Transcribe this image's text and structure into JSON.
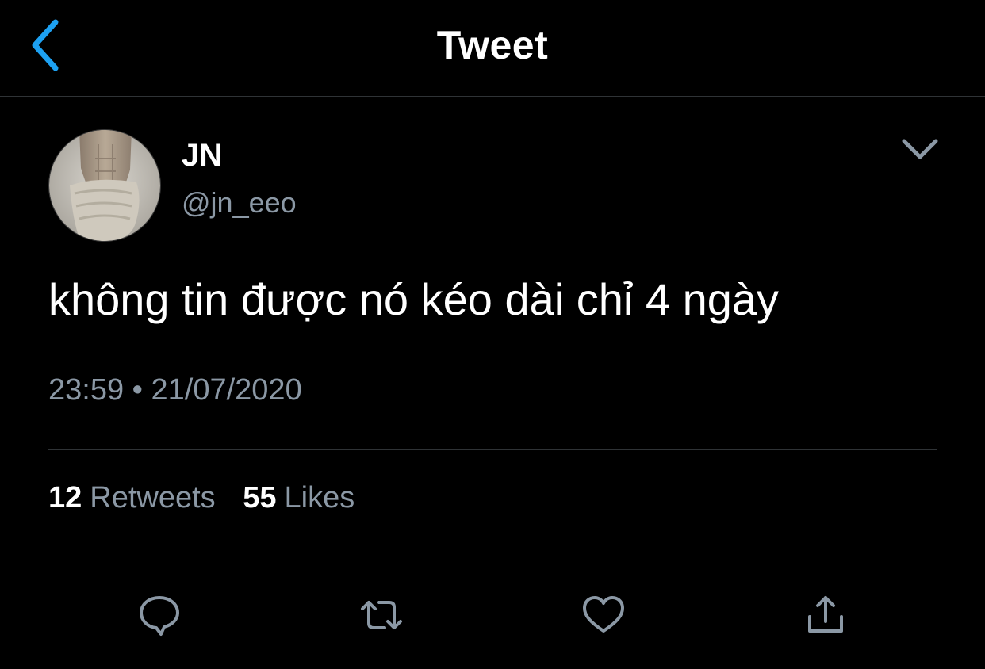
{
  "header": {
    "back_icon": "chevron-left-icon",
    "title": "Tweet",
    "accent_color": "#1da1f2"
  },
  "tweet": {
    "author": {
      "display_name": "JN",
      "handle": "@jn_eeo",
      "avatar": "avatar-photo"
    },
    "menu_icon": "chevron-down-icon",
    "text": "không tin được nó kéo dài chỉ 4 ngày",
    "timestamp": "23:59 • 21/07/2020",
    "stats": {
      "retweets_count": "12",
      "retweets_label": "Retweets",
      "likes_count": "55",
      "likes_label": "Likes"
    },
    "actions": [
      {
        "icon": "reply-icon"
      },
      {
        "icon": "retweet-icon"
      },
      {
        "icon": "like-heart-icon"
      },
      {
        "icon": "share-icon"
      }
    ]
  },
  "colors": {
    "background": "#000000",
    "primary_text": "#ffffff",
    "secondary_text": "#8b98a5",
    "divider": "#2f3336"
  }
}
